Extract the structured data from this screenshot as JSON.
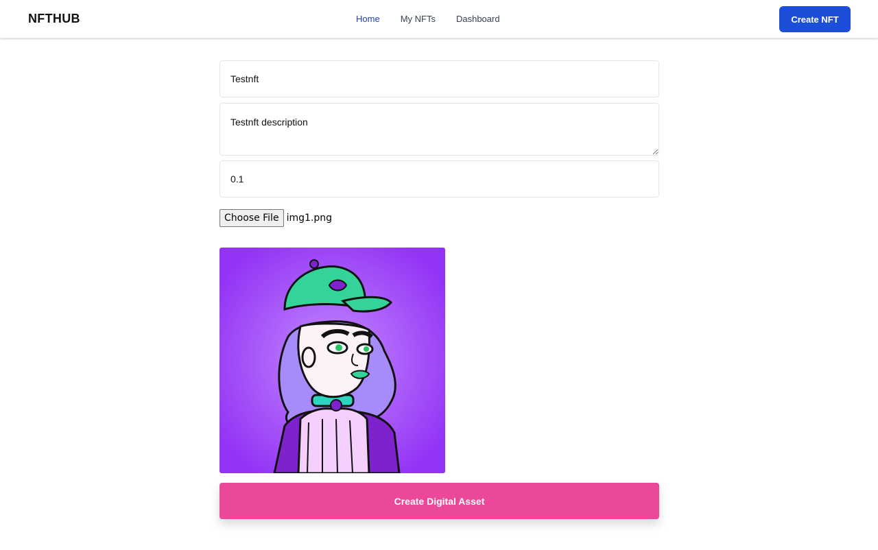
{
  "navbar": {
    "brand": "NFTHUB",
    "links": [
      {
        "label": "Home",
        "active": true
      },
      {
        "label": "My NFTs",
        "active": false
      },
      {
        "label": "Dashboard",
        "active": false
      }
    ],
    "create_button": "Create NFT"
  },
  "form": {
    "name_value": "Testnft",
    "description_value": "Testnft description",
    "price_value": "0.1",
    "file_button": "Choose File",
    "file_name": "img1.png",
    "submit_label": "Create Digital Asset"
  },
  "preview": {
    "icon": "nft-artwork-image"
  },
  "colors": {
    "primary": "#1d4ed8",
    "accent": "#ec4899",
    "nav_active": "#1e40af"
  }
}
